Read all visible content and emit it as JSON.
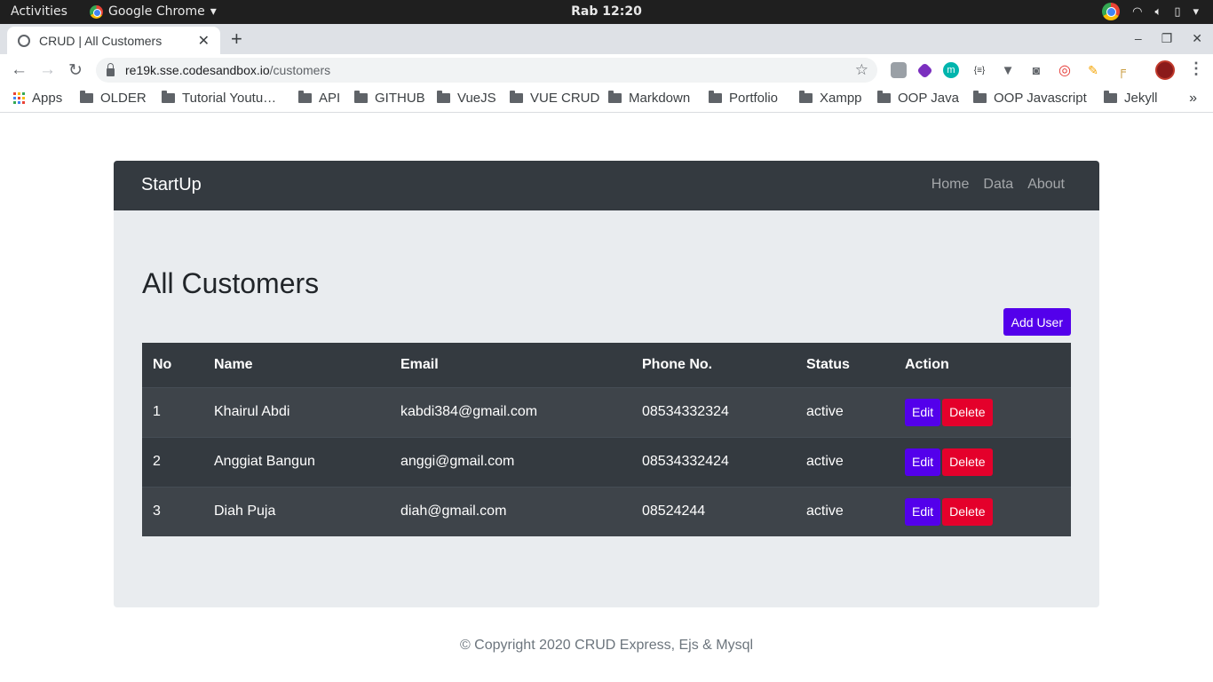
{
  "os_bar": {
    "activities": "Activities",
    "app_name": "Google Chrome",
    "clock": "Rab 12:20"
  },
  "browser": {
    "tab_title": "CRUD | All Customers",
    "url_host": "re19k.sse.codesandbox.io",
    "url_path": "/customers",
    "bookmarks": [
      "Apps",
      "OLDER",
      "Tutorial Youtu…",
      "API",
      "GITHUB",
      "VueJS",
      "VUE CRUD",
      "Markdown",
      "Portfolio",
      "Xampp",
      "OOP Java",
      "OOP Javascript",
      "Jekyll"
    ]
  },
  "navbar": {
    "brand": "StartUp",
    "links": [
      "Home",
      "Data",
      "About"
    ]
  },
  "main": {
    "heading": "All Customers",
    "add_button": "Add User",
    "table": {
      "headers": [
        "No",
        "Name",
        "Email",
        "Phone No.",
        "Status",
        "Action"
      ],
      "rows": [
        {
          "no": "1",
          "name": "Khairul Abdi",
          "email": "kabdi384@gmail.com",
          "phone": "08534332324",
          "status": "active"
        },
        {
          "no": "2",
          "name": "Anggiat Bangun",
          "email": "anggi@gmail.com",
          "phone": "08534332424",
          "status": "active"
        },
        {
          "no": "3",
          "name": "Diah Puja",
          "email": "diah@gmail.com",
          "phone": "08524244",
          "status": "active"
        }
      ],
      "edit_label": "Edit",
      "delete_label": "Delete"
    }
  },
  "footer": {
    "copyright": "© Copyright 2020 CRUD Express, Ejs & Mysql"
  },
  "colors": {
    "navbar_bg": "#343a40",
    "primary": "#5300eb",
    "danger": "#e4002b",
    "card_bg": "#e9ecef"
  }
}
